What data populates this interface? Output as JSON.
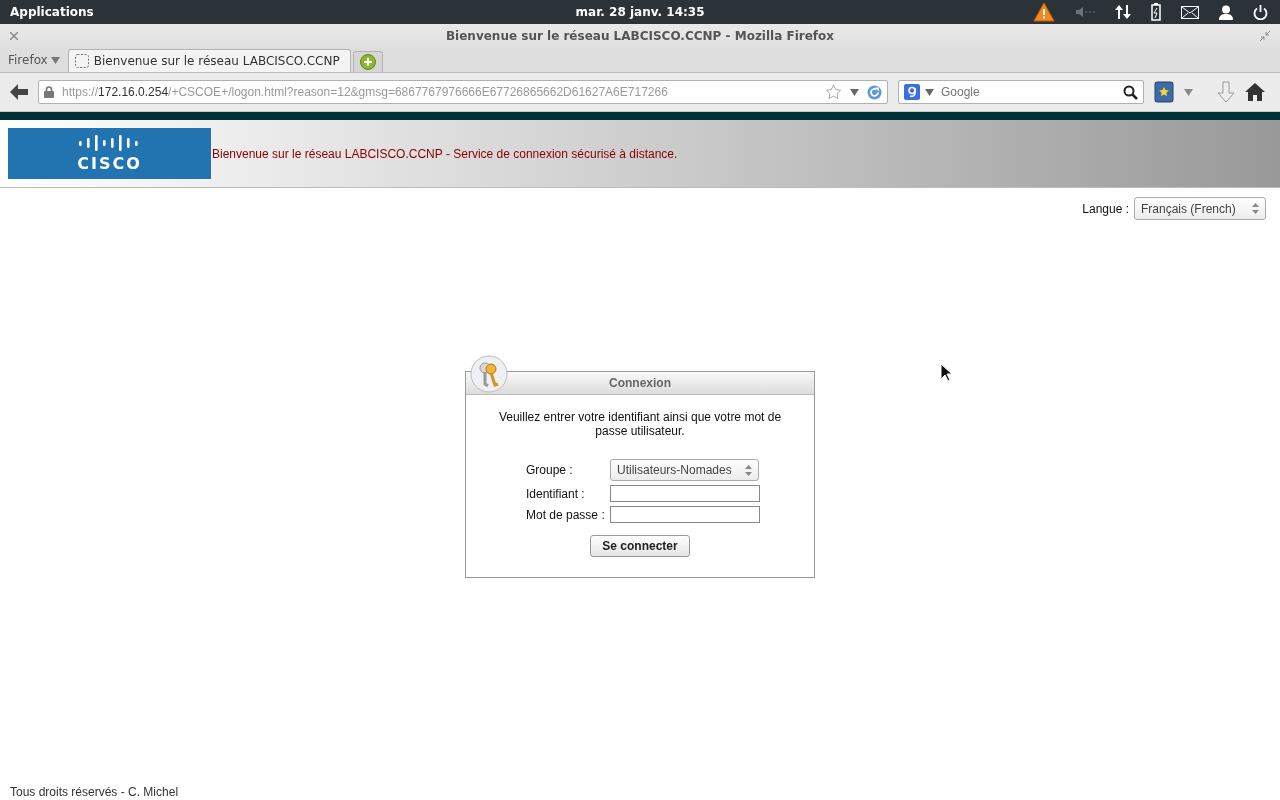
{
  "top_panel": {
    "menu": "Applications",
    "clock": "mar. 28 janv. 14:35"
  },
  "window": {
    "title": "Bienvenue sur le réseau LABCISCO.CCNP - Mozilla Firefox"
  },
  "firefox_menu": "Firefox",
  "tabs": [
    {
      "label": "Bienvenue sur le réseau LABCISCO.CCNP",
      "selected": true
    }
  ],
  "url": {
    "scheme": "https://",
    "host": "172.16.0.254",
    "path": "/+CSCOE+/logon.html?reason=12&gmsg=6867767976666E67726865662D61627A6E717266"
  },
  "search": {
    "placeholder": "Google"
  },
  "header": {
    "logo": "CISCO",
    "message": "Bienvenue sur le réseau LABCISCO.CCNP - Service de connexion sécurisé à distance."
  },
  "language": {
    "label": "Langue :",
    "value": "Français (French)"
  },
  "login": {
    "title": "Connexion",
    "intro": "Veuillez entrer votre identifiant ainsi que votre mot de passe utilisateur.",
    "fields": [
      {
        "kind": "select",
        "label": "Groupe :",
        "value": "Utilisateurs-Nomades"
      },
      {
        "kind": "text",
        "label": "Identifiant :"
      },
      {
        "kind": "password",
        "label": "Mot de passe :"
      }
    ],
    "button": "Se connecter"
  },
  "footer": "Tous droits réservés - C. Michel"
}
